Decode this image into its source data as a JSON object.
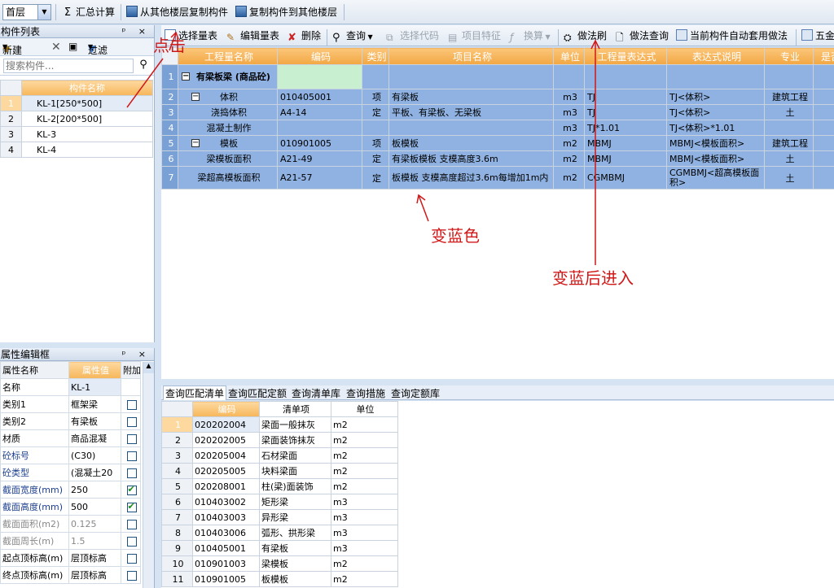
{
  "toolbar_top": {
    "floor": "首层",
    "sum": "汇总计算",
    "copy_from": "从其他楼层复制构件",
    "copy_to": "复制构件到其他楼层"
  },
  "component_list": {
    "title": "构件列表",
    "controls": "ᵖ ×",
    "new_label": "新建",
    "filter_label": "过滤",
    "search_placeholder": "搜索构件...",
    "column_header": "构件名称",
    "items": [
      "KL-1[250*500]",
      "KL-2[200*500]",
      "KL-3",
      "KL-4"
    ]
  },
  "property_panel": {
    "title": "属性编辑框",
    "controls": "ᵖ ×",
    "headers": [
      "属性名称",
      "属性值",
      "附加"
    ],
    "rows": [
      {
        "name": "名称",
        "value": "KL-1",
        "checked": null
      },
      {
        "name": "类别1",
        "value": "框架梁",
        "checked": false
      },
      {
        "name": "类别2",
        "value": "有梁板",
        "checked": false
      },
      {
        "name": "材质",
        "value": "商品混凝",
        "checked": false
      },
      {
        "name": "砼标号",
        "value": "(C30)",
        "checked": false
      },
      {
        "name": "砼类型",
        "value": "(混凝土20",
        "checked": false
      },
      {
        "name": "截面宽度(mm)",
        "value": "250",
        "checked": true
      },
      {
        "name": "截面高度(mm)",
        "value": "500",
        "checked": true
      },
      {
        "name": "截面面积(m2)",
        "value": "0.125",
        "checked": false
      },
      {
        "name": "截面周长(m)",
        "value": "1.5",
        "checked": false
      },
      {
        "name": "起点顶标高(m)",
        "value": "层顶标高",
        "checked": false
      },
      {
        "name": "终点顶标高(m)",
        "value": "层顶标高",
        "checked": false
      }
    ]
  },
  "main_toolbar": {
    "select_qty": "选择量表",
    "edit_qty": "编辑量表",
    "delete": "删除",
    "query": "查询",
    "select_code": "选择代码",
    "item_feature": "项目特征",
    "convert": "换算",
    "method_brush": "做法刷",
    "method_query": "做法查询",
    "auto_apply": "当前构件自动套用做法",
    "five_gold": "五金"
  },
  "main_grid": {
    "headers": [
      "工程量名称",
      "编码",
      "类别",
      "项目名称",
      "单位",
      "工程量表达式",
      "表达式说明",
      "专业",
      "是否"
    ],
    "rows": [
      {
        "n": "1",
        "name": "有梁板梁 (商品砼)",
        "code": "",
        "cat": "",
        "proj": "",
        "unit": "",
        "expr": "",
        "desc": "",
        "major": ""
      },
      {
        "n": "2",
        "name": "体积",
        "code": "010405001",
        "cat": "项",
        "proj": "有梁板",
        "unit": "m3",
        "expr": "TJ",
        "desc": "TJ<体积>",
        "major": "建筑工程"
      },
      {
        "n": "3",
        "name": "浇捣体积",
        "code": "A4-14",
        "cat": "定",
        "proj": "平板、有梁板、无梁板",
        "unit": "m3",
        "expr": "TJ",
        "desc": "TJ<体积>",
        "major": "土"
      },
      {
        "n": "4",
        "name": "混凝土制作",
        "code": "",
        "cat": "",
        "proj": "",
        "unit": "m3",
        "expr": "TJ*1.01",
        "desc": "TJ<体积>*1.01",
        "major": ""
      },
      {
        "n": "5",
        "name": "模板",
        "code": "010901005",
        "cat": "项",
        "proj": "板模板",
        "unit": "m2",
        "expr": "MBMJ",
        "desc": "MBMJ<模板面积>",
        "major": "建筑工程"
      },
      {
        "n": "6",
        "name": "梁模板面积",
        "code": "A21-49",
        "cat": "定",
        "proj": "有梁板模板 支模高度3.6m",
        "unit": "m2",
        "expr": "MBMJ",
        "desc": "MBMJ<模板面积>",
        "major": "土"
      },
      {
        "n": "7",
        "name": "梁超高模板面积",
        "code": "A21-57",
        "cat": "定",
        "proj": "板模板 支模高度超过3.6m每增加1m内",
        "unit": "m2",
        "expr": "CGMBMJ",
        "desc": "CGMBMJ<超高模板面积>",
        "major": "土"
      }
    ]
  },
  "bottom_tabs": [
    "查询匹配清单",
    "查询匹配定额",
    "查询清单库",
    "查询措施",
    "查询定额库"
  ],
  "bottom_grid": {
    "headers": [
      "编码",
      "清单项",
      "单位"
    ],
    "rows": [
      {
        "n": "1",
        "code": "020202004",
        "item": "梁面一般抹灰",
        "unit": "m2"
      },
      {
        "n": "2",
        "code": "020202005",
        "item": "梁面装饰抹灰",
        "unit": "m2"
      },
      {
        "n": "3",
        "code": "020205004",
        "item": "石材梁面",
        "unit": "m2"
      },
      {
        "n": "4",
        "code": "020205005",
        "item": "块料梁面",
        "unit": "m2"
      },
      {
        "n": "5",
        "code": "020208001",
        "item": "柱(梁)面装饰",
        "unit": "m2"
      },
      {
        "n": "6",
        "code": "010403002",
        "item": "矩形梁",
        "unit": "m3"
      },
      {
        "n": "7",
        "code": "010403003",
        "item": "异形梁",
        "unit": "m3"
      },
      {
        "n": "8",
        "code": "010403006",
        "item": "弧形、拱形梁",
        "unit": "m3"
      },
      {
        "n": "9",
        "code": "010405001",
        "item": "有梁板",
        "unit": "m3"
      },
      {
        "n": "10",
        "code": "010901003",
        "item": "梁模板",
        "unit": "m2"
      },
      {
        "n": "11",
        "code": "010901005",
        "item": "板模板",
        "unit": "m2"
      }
    ]
  },
  "annotations": {
    "click": "点击",
    "turn_blue": "变蓝色",
    "enter_after_blue": "变蓝后进入"
  }
}
